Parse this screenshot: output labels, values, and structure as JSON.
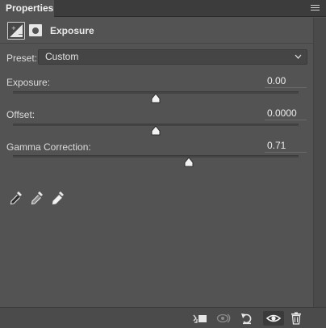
{
  "panel": {
    "tab_label": "Properties",
    "title": "Exposure"
  },
  "preset": {
    "label": "Preset:",
    "value": "Custom"
  },
  "sliders": [
    {
      "label": "Exposure:",
      "value": "0.00",
      "position": 0.5
    },
    {
      "label": "Offset:",
      "value": "0.0000",
      "position": 0.5
    },
    {
      "label": "Gamma Correction:",
      "value": "0.71",
      "position": 0.615
    }
  ],
  "eyedroppers": [
    "black-point-eyedropper-icon",
    "gray-point-eyedropper-icon",
    "white-point-eyedropper-icon"
  ],
  "bottom_toolbar": [
    "clip-to-layer-icon",
    "view-previous-state-icon",
    "reset-icon",
    "visibility-eye-icon",
    "trash-icon"
  ],
  "colors": {
    "panel_bg": "#535353",
    "tab_bar_bg": "#3c3c3c",
    "text": "#dcdcdc",
    "thumb": "#f2f2f2"
  }
}
